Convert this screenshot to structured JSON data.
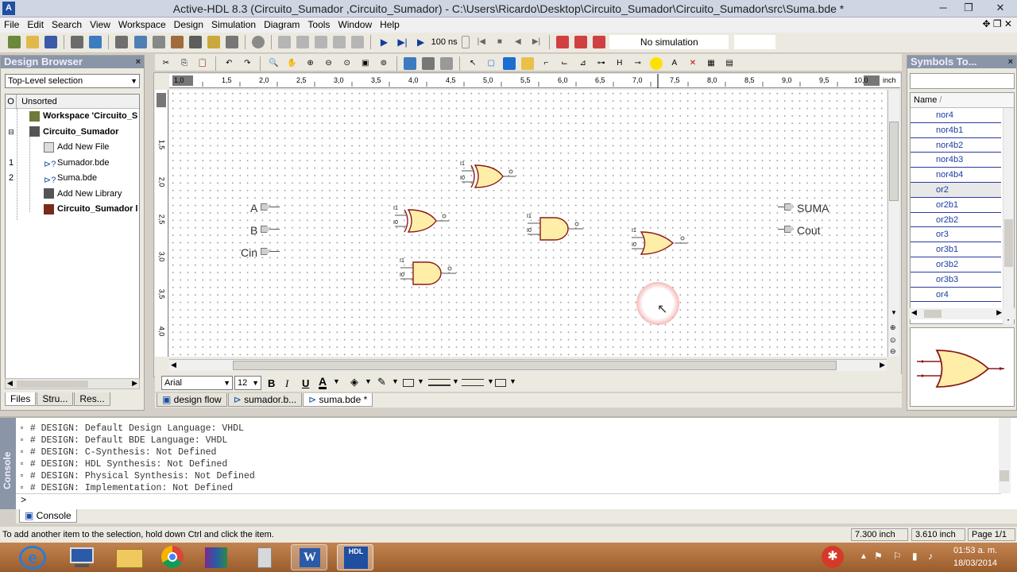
{
  "app": {
    "logo": "A",
    "title": "Active-HDL 8.3 (Circuito_Sumador ,Circuito_Sumador) - C:\\Users\\Ricardo\\Desktop\\Circuito_Sumador\\Circuito_Sumador\\src\\Suma.bde *"
  },
  "window_controls": {
    "minimize": "─",
    "restore": "❐",
    "close": "✕"
  },
  "menu": [
    "File",
    "Edit",
    "Search",
    "View",
    "Workspace",
    "Design",
    "Simulation",
    "Diagram",
    "Tools",
    "Window",
    "Help"
  ],
  "menu_right": "✥ ❐ ✕",
  "sim_toolbar": {
    "time_value": "100 ns",
    "status": "No simulation"
  },
  "design_browser": {
    "title": "Design Browser",
    "close": "×",
    "selection": "Top-Level selection",
    "sort_header_col": "O",
    "sort_header_label": "Unsorted",
    "items": [
      {
        "num": "",
        "label": "Workspace 'Circuito_S",
        "bold": true,
        "indent": 1
      },
      {
        "num": "",
        "label": "Circuito_Sumador",
        "bold": true,
        "indent": 1
      },
      {
        "num": "",
        "label": "Add New File",
        "bold": false,
        "indent": 3
      },
      {
        "num": "1",
        "label": "Sumador.bde",
        "bold": false,
        "indent": 3
      },
      {
        "num": "2",
        "label": "Suma.bde",
        "bold": false,
        "indent": 3
      },
      {
        "num": "",
        "label": "Add New Library",
        "bold": false,
        "indent": 3
      },
      {
        "num": "",
        "label": "Circuito_Sumador l",
        "bold": true,
        "indent": 3
      }
    ],
    "tabs": [
      "Files",
      "Stru...",
      "Res..."
    ]
  },
  "ruler": {
    "unit": "inch",
    "h_labels": [
      "1,0",
      "1,5",
      "2,0",
      "2,5",
      "3,0",
      "3,5",
      "4,0",
      "4,5",
      "5,0",
      "5,5",
      "6,0",
      "6,5",
      "7,0",
      "7,5",
      "8,0",
      "8,5",
      "9,0",
      "9,5",
      "10,0"
    ],
    "v_labels": [
      "1,5",
      "2,0",
      "2,5",
      "3,0",
      "3,5",
      "4,0"
    ]
  },
  "schematic": {
    "ports_in": [
      "A",
      "B",
      "Cin"
    ],
    "ports_out": [
      "SUMA",
      "Cout"
    ],
    "pin_in1": "I1",
    "pin_in0": "I0",
    "pin_out": "O"
  },
  "format_toolbar": {
    "font": "Arial",
    "size": "12",
    "bold": "B",
    "italic": "I",
    "underline": "U",
    "color": "A"
  },
  "doc_tabs": [
    "design flow",
    "sumador.b...",
    "suma.bde *"
  ],
  "symbols": {
    "title": "Symbols To...",
    "close": "×",
    "col_header": "Name",
    "sort_mark": "/",
    "items": [
      "nor4",
      "nor4b1",
      "nor4b2",
      "nor4b3",
      "nor4b4",
      "or2",
      "or2b1",
      "or2b2",
      "or3",
      "or3b1",
      "or3b2",
      "or3b3",
      "or4"
    ]
  },
  "console": {
    "side_label": "Console",
    "lines": [
      "# DESIGN: Default Design Language: VHDL",
      "# DESIGN: Default BDE Language: VHDL",
      "# DESIGN: C-Synthesis: Not Defined",
      "# DESIGN: HDL Synthesis: Not Defined",
      "# DESIGN: Physical Synthesis: Not Defined",
      "# DESIGN: Implementation: Not Defined"
    ],
    "prompt": ">",
    "tab": "Console"
  },
  "status": {
    "message": "To add another item to the selection, hold down Ctrl and click the item.",
    "x": "7.300 inch",
    "y": "3.610 inch",
    "page": "Page 1/1"
  },
  "taskbar": {
    "hdl_label": "HDL",
    "word_label": "W",
    "time": "01:53 a. m.",
    "date": "18/03/2014"
  },
  "colors": {
    "gate_fill": "#ffeea8",
    "gate_stroke": "#8b1a1a",
    "panel_title": "#8a95a7"
  }
}
